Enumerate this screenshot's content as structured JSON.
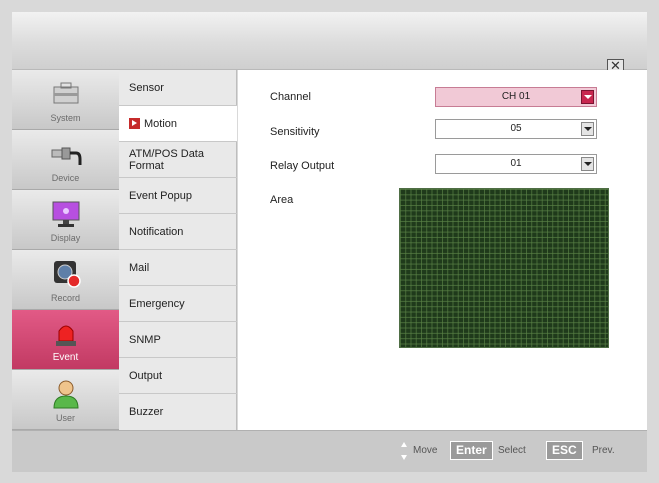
{
  "window": {
    "close_symbol": "✕"
  },
  "categories": [
    {
      "label": "System",
      "icon": "toolbox-icon"
    },
    {
      "label": "Device",
      "icon": "usb-cable-icon"
    },
    {
      "label": "Display",
      "icon": "monitor-icon"
    },
    {
      "label": "Record",
      "icon": "camera-record-icon"
    },
    {
      "label": "Event",
      "icon": "alarm-siren-icon",
      "active": true
    },
    {
      "label": "User",
      "icon": "user-icon"
    }
  ],
  "submenu": [
    {
      "label": "Sensor"
    },
    {
      "label": "Motion",
      "active": true
    },
    {
      "label": "ATM/POS Data Format"
    },
    {
      "label": "Event Popup"
    },
    {
      "label": "Notification"
    },
    {
      "label": "Mail"
    },
    {
      "label": "Emergency"
    },
    {
      "label": "SNMP"
    },
    {
      "label": "Output"
    },
    {
      "label": "Buzzer"
    }
  ],
  "settings": {
    "channel": {
      "label": "Channel",
      "value": "CH 01"
    },
    "sensitivity": {
      "label": "Sensitivity",
      "value": "05"
    },
    "relay_output": {
      "label": "Relay Output",
      "value": "01"
    },
    "area": {
      "label": "Area"
    }
  },
  "footer": {
    "move": "Move",
    "enter_key": "Enter",
    "select": "Select",
    "esc_key": "ESC",
    "prev": "Prev."
  },
  "colors": {
    "accent": "#c8264f",
    "grid": "#1f3a1b"
  }
}
